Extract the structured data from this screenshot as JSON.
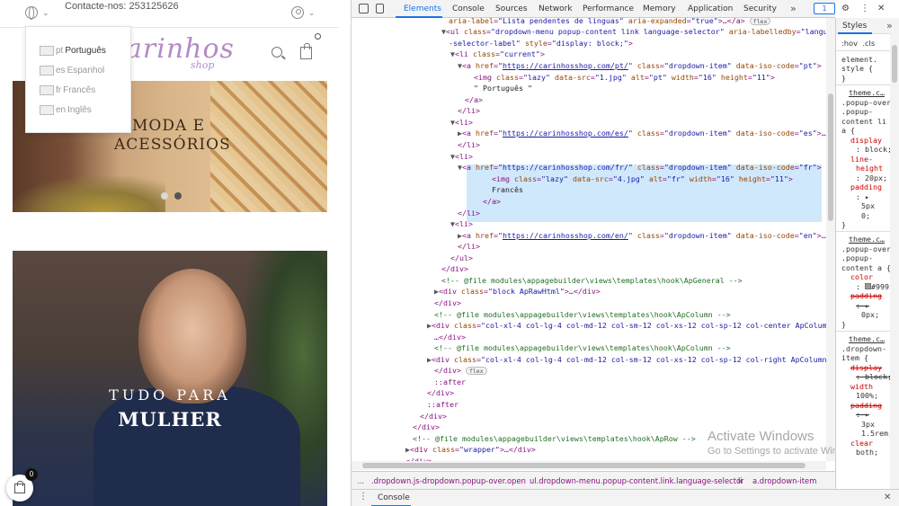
{
  "site": {
    "contact": "Contacte-nos: 253125626",
    "logo_text": "arinhos",
    "logo_sub": "shop",
    "cart_count_header": "0",
    "cart_count_float": "0",
    "banner1": {
      "line1": "MODA E",
      "line2": "ACESSÓRIOS"
    },
    "banner2": {
      "line1": "TUDO PARA",
      "line2": "MULHER"
    },
    "language_menu": [
      {
        "code": "pt",
        "label": "Português",
        "current": true
      },
      {
        "code": "es",
        "label": "Espanhol",
        "current": false
      },
      {
        "code": "fr",
        "label": "Francês",
        "current": false
      },
      {
        "code": "en",
        "label": "Inglês",
        "current": false
      }
    ],
    "slider_dot_active": "#d9d9d9",
    "slider_dot_inactive": "#555555"
  },
  "devtools": {
    "tabs": [
      "Elements",
      "Console",
      "Sources",
      "Network",
      "Performance",
      "Memory",
      "Application",
      "Security"
    ],
    "active_tab": "Elements",
    "more_tabs": "»",
    "issues_badge": "1",
    "watermark_title": "Activate Windows",
    "watermark_sub": "Go to Settings to activate Windows.",
    "breadcrumb": [
      "...",
      ".dropdown.js-dropdown.popup-over.open",
      "ul.dropdown-menu.popup-content.link.language-selector",
      "li",
      "a.dropdown-item"
    ],
    "drawer_tab": "Console",
    "styles": {
      "tab": "Styles",
      "more": "»",
      "filter_hov": ":hov",
      "filter_cls": ".cls",
      "element_style": "element.",
      "element_style_2": "style {",
      "close_brace": "}",
      "src1": "theme.c…",
      "sel1": [
        ".popup-over",
        ".popup-",
        "content li",
        "a {"
      ],
      "props1": [
        {
          "name": "display",
          "value": "block;"
        },
        {
          "name": "line-",
          "value": ""
        },
        {
          "name": "height",
          "value": "20px;"
        },
        {
          "name": "padding",
          "value": "5px"
        },
        {
          "name": "",
          "value": "0;"
        }
      ],
      "src2": "theme.c…",
      "sel2": [
        ".popup-over",
        ".popup-",
        "content a {"
      ],
      "props2": [
        {
          "name": "color",
          "value": "#999"
        },
        {
          "name": "padding",
          "value": "0px;"
        }
      ],
      "src3": "theme.c…",
      "sel3": [
        ".dropdown-",
        "item {"
      ],
      "props3": [
        {
          "name": "display",
          "value": "block;"
        },
        {
          "name": "width",
          "value": "100%;"
        },
        {
          "name": "padding",
          "value": "3px"
        },
        {
          "name": "",
          "value": "1.5rem;"
        },
        {
          "name": "clear",
          "value": "both;"
        }
      ]
    }
  },
  "colors": {
    "accent": "#1a73e8",
    "tag": "#881280",
    "attr_name": "#994500",
    "attr_value": "#1a1aa6",
    "comment": "#236e25",
    "selection": "#cfe8fc",
    "logo": "#b48ac6"
  }
}
